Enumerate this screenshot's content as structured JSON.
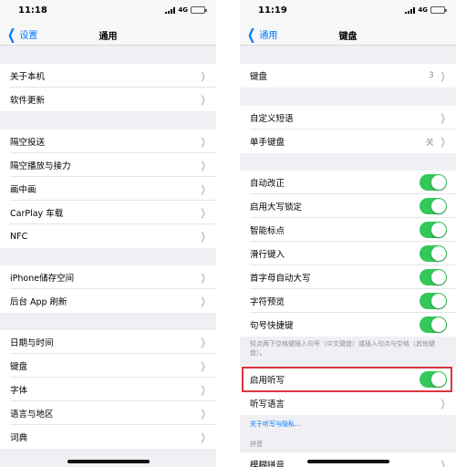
{
  "left": {
    "time": "11:18",
    "network": "4G",
    "back_label": "设置",
    "title": "通用",
    "rows": [
      {
        "label": "关于本机"
      },
      {
        "label": "软件更新"
      },
      {
        "label": "隔空投送"
      },
      {
        "label": "隔空播放与接力"
      },
      {
        "label": "画中画"
      },
      {
        "label": "CarPlay 车载"
      },
      {
        "label": "NFC"
      },
      {
        "label": "iPhone储存空间"
      },
      {
        "label": "后台 App 刷新"
      },
      {
        "label": "日期与时间"
      },
      {
        "label": "键盘"
      },
      {
        "label": "字体"
      },
      {
        "label": "语言与地区"
      },
      {
        "label": "词典"
      }
    ]
  },
  "right": {
    "time": "11:19",
    "network": "4G",
    "back_label": "通用",
    "title": "键盘",
    "keyboards": {
      "label": "键盘",
      "value": "3"
    },
    "text_replacement": {
      "label": "自定义短语"
    },
    "one_handed": {
      "label": "单手键盘",
      "value": "关"
    },
    "toggles": [
      {
        "label": "自动改正",
        "on": true
      },
      {
        "label": "启用大写锁定",
        "on": true
      },
      {
        "label": "智能标点",
        "on": true
      },
      {
        "label": "滑行键入",
        "on": true
      },
      {
        "label": "首字母自动大写",
        "on": true
      },
      {
        "label": "字符预览",
        "on": true
      },
      {
        "label": "句号快捷键",
        "on": true
      }
    ],
    "period_note": "轻点两下空格键插入句号（中文键盘）或插入句点与空格（其他键盘）。",
    "dictation": {
      "label": "启用听写",
      "on": true
    },
    "dictation_language": {
      "label": "听写语言"
    },
    "dictation_link": "关于听写与隐私...",
    "pinyin_header": "拼音",
    "fuzzy_pinyin": {
      "label": "模糊拼音"
    }
  },
  "colors": {
    "accent": "#007aff",
    "toggle_on": "#34c759",
    "highlight": "#d9363e"
  }
}
